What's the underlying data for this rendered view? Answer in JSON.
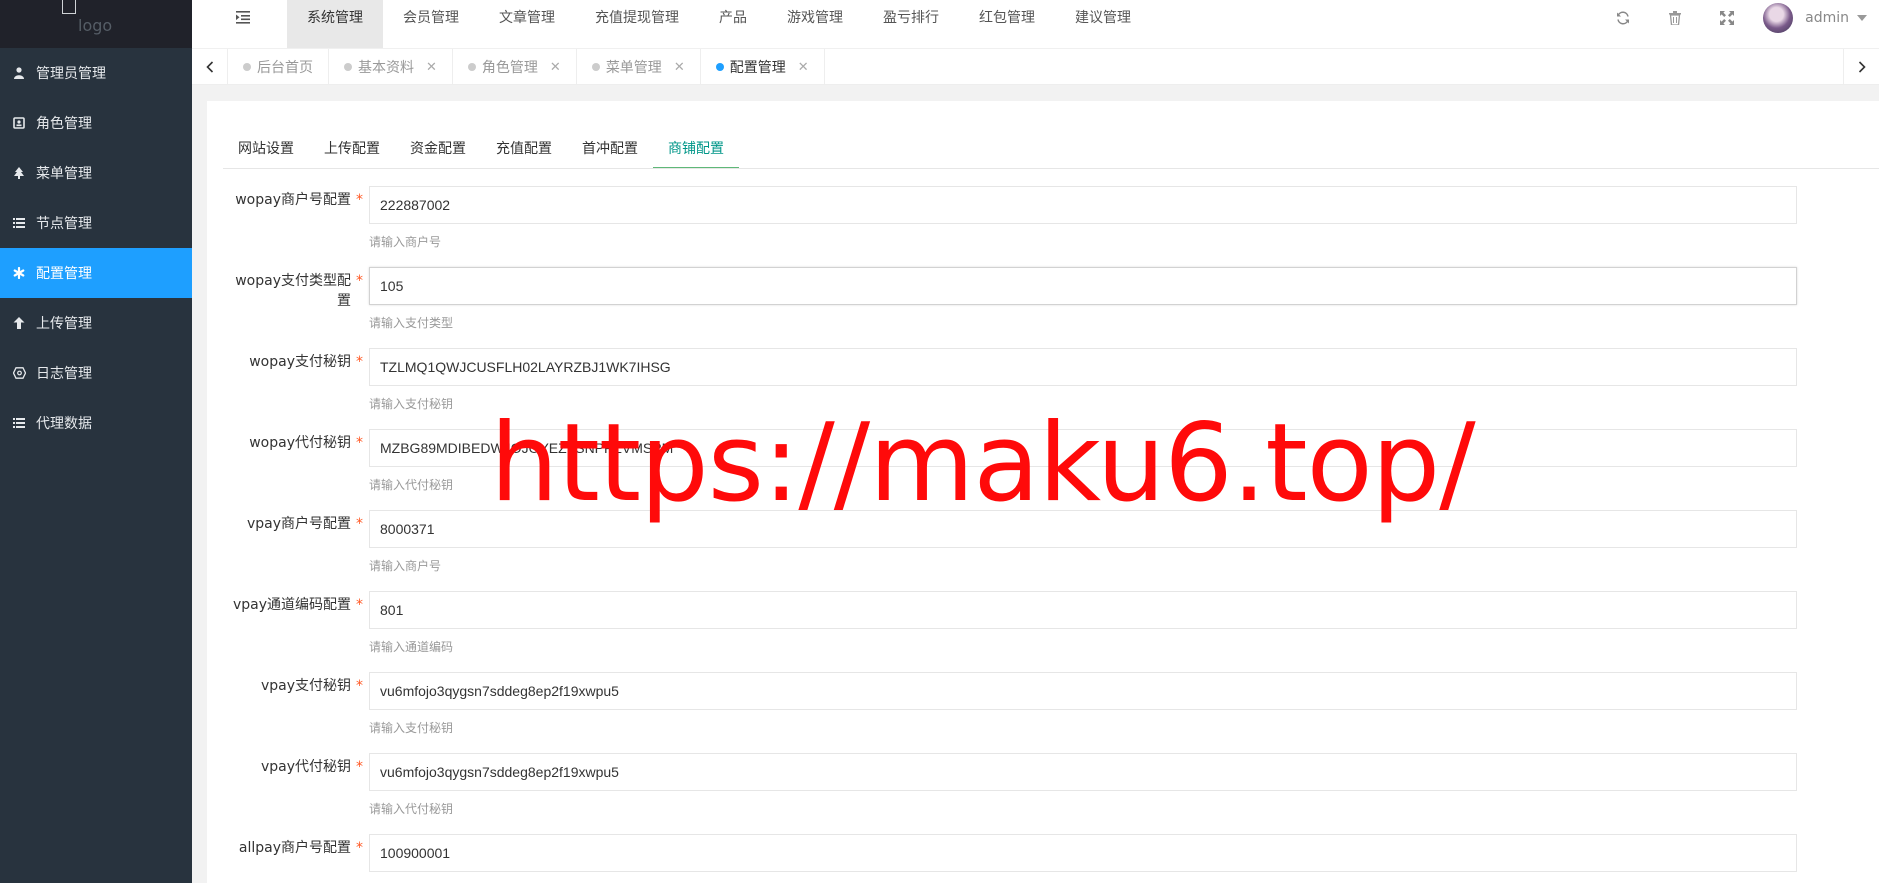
{
  "sidebar": {
    "logo_text": "logo",
    "items": [
      {
        "label": "管理员管理",
        "icon": "user-icon"
      },
      {
        "label": "角色管理",
        "icon": "role-icon"
      },
      {
        "label": "菜单管理",
        "icon": "tree-icon"
      },
      {
        "label": "节点管理",
        "icon": "list-icon"
      },
      {
        "label": "配置管理",
        "icon": "asterisk-icon",
        "active": true
      },
      {
        "label": "上传管理",
        "icon": "upload-icon"
      },
      {
        "label": "日志管理",
        "icon": "log-icon"
      },
      {
        "label": "代理数据",
        "icon": "list-icon"
      }
    ]
  },
  "header": {
    "nav": [
      "系统管理",
      "会员管理",
      "文章管理",
      "充值提现管理",
      "产品",
      "游戏管理",
      "盈亏排行",
      "红包管理",
      "建议管理"
    ],
    "active_nav": "系统管理",
    "username": "admin",
    "icons": [
      "refresh-icon",
      "trash-icon",
      "fullscreen-icon"
    ]
  },
  "page_tabs": [
    {
      "label": "后台首页"
    },
    {
      "label": "基本资料",
      "closable": true
    },
    {
      "label": "角色管理",
      "closable": true
    },
    {
      "label": "菜单管理",
      "closable": true
    },
    {
      "label": "配置管理",
      "closable": true,
      "active": true
    }
  ],
  "config_tabs": [
    "网站设置",
    "上传配置",
    "资金配置",
    "充值配置",
    "首冲配置",
    "商铺配置"
  ],
  "active_config_tab": "商铺配置",
  "form": {
    "fields": [
      {
        "label": "wopay商户号配置",
        "value": "222887002",
        "help": "请输入商户号"
      },
      {
        "label": "wopay支付类型配置",
        "value": "105",
        "help": "请输入支付类型"
      },
      {
        "label": "wopay支付秘钥",
        "value": "TZLMQ1QWJCUSFLH02LAYRZBJ1WK7IHSG",
        "help": "请输入支付秘钥"
      },
      {
        "label": "wopay代付秘钥",
        "value": "MZBG89MDIBEDWJOJOYEZTSNPFEVMSPM",
        "help": "请输入代付秘钥"
      },
      {
        "label": "vpay商户号配置",
        "value": "8000371",
        "help": "请输入商户号"
      },
      {
        "label": "vpay通道编码配置",
        "value": "801",
        "help": "请输入通道编码"
      },
      {
        "label": "vpay支付秘钥",
        "value": "vu6mfojo3qygsn7sddeg8ep2f19xwpu5",
        "help": "请输入支付秘钥"
      },
      {
        "label": "vpay代付秘钥",
        "value": "vu6mfojo3qygsn7sddeg8ep2f19xwpu5",
        "help": "请输入代付秘钥"
      },
      {
        "label": "allpay商户号配置",
        "value": "100900001",
        "help": ""
      }
    ],
    "required_mark": "*"
  },
  "watermark": "https://maku6.top/",
  "colors": {
    "sidebar_bg": "#28333e",
    "active_blue": "#1e9fff",
    "tab_green": "#009688",
    "watermark_red": "#ff0a0a"
  }
}
